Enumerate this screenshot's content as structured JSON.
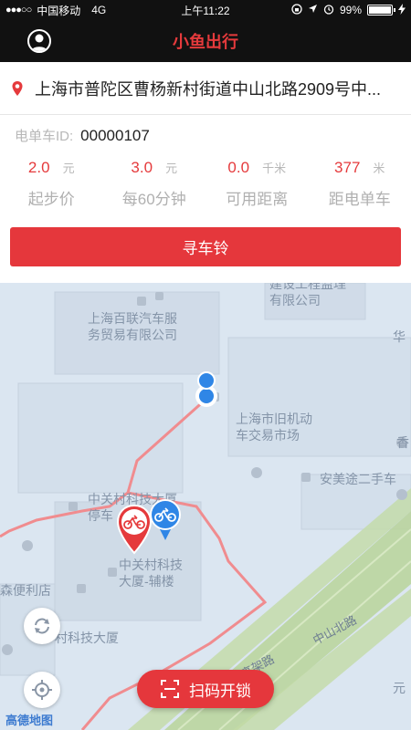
{
  "status_bar": {
    "carrier": "中国移动",
    "network": "4G",
    "time": "上午11:22",
    "battery": "99%",
    "battery_level": 0.99
  },
  "header": {
    "title": "小鱼出行"
  },
  "address": {
    "text": "上海市普陀区曹杨新村街道中山北路2909号中..."
  },
  "bike": {
    "id_label": "电单车ID:",
    "id_value": "00000107"
  },
  "stats": [
    {
      "value": "2.0",
      "unit": "元",
      "label": "起步价"
    },
    {
      "value": "3.0",
      "unit": "元",
      "label": "每60分钟"
    },
    {
      "value": "0.0",
      "unit": "千米",
      "label": "可用距离"
    },
    {
      "value": "377",
      "unit": "米",
      "label": "距电单车"
    }
  ],
  "find_button": {
    "label": "寻车铃"
  },
  "map": {
    "labels": {
      "jianshe": "建设工程监理\n有限公司",
      "bailian": "上海百联汽车服\n务贸易有限公司",
      "hua": "华",
      "jiuji": "上海市旧机动\n车交易市场",
      "xiang": "香",
      "anmei": "安美途二手车",
      "zhongguancun_top": "中关村科技大厦\n停车",
      "zhongguancun_annex": "中关村科技\n大厦-辅楼",
      "bianlidian": "森便利店",
      "keji_dasha": "村科技大厦",
      "zhongshan": "中山北路",
      "gaojia": "高架路",
      "yuan": "元"
    },
    "scan_button_label": "扫码开锁",
    "logo": "高德地图"
  },
  "colors": {
    "accent": "#e53a3c",
    "dark": "#111111",
    "route": "#f28b8e",
    "map_bg": "#dbe6f1",
    "road": "#b3d08c"
  }
}
